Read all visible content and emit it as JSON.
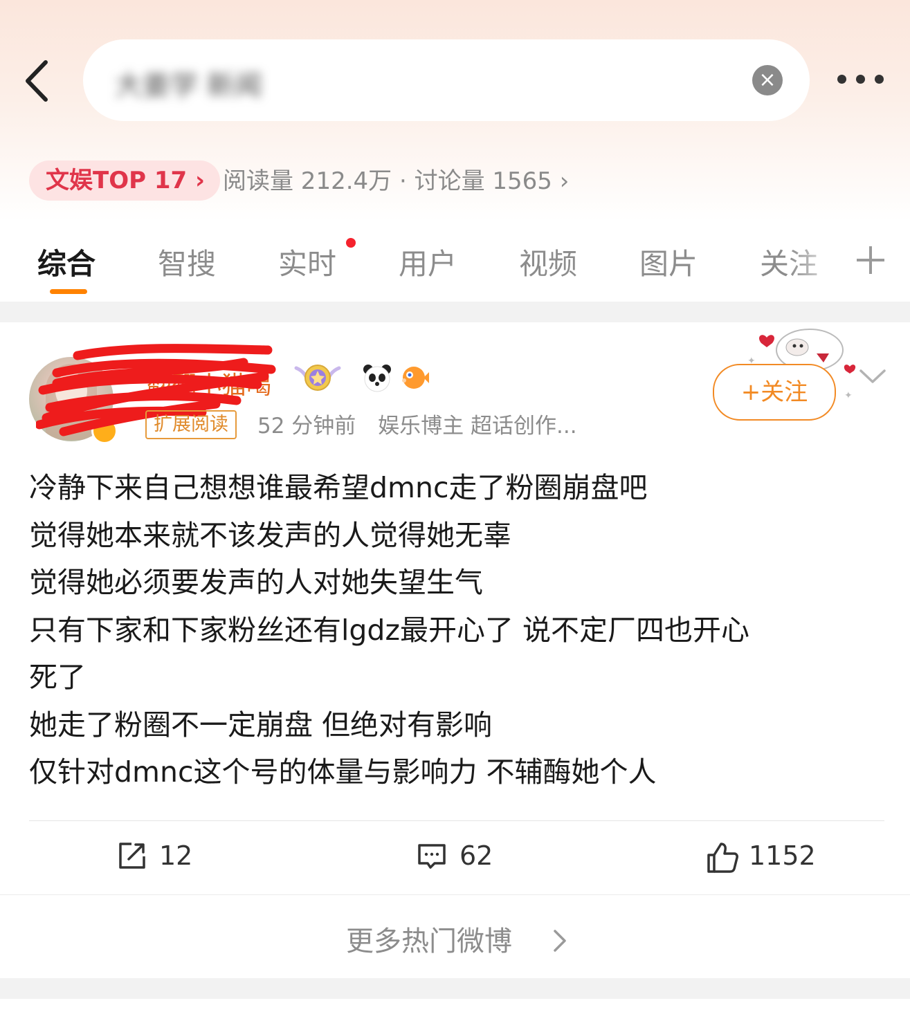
{
  "header": {
    "search_query": "大姜学 新闻",
    "icons": {
      "back": "back-chevron-icon",
      "clear": "clear-x-icon",
      "more": "more-dots-icon"
    }
  },
  "topic": {
    "rank_label": "文娱TOP 17 ›",
    "stats": "阅读量 212.4万 · 讨论量 1565 ›"
  },
  "tabs": [
    {
      "label": "综合",
      "active": true
    },
    {
      "label": "智搜"
    },
    {
      "label": "实时",
      "has_dot": true
    },
    {
      "label": "用户"
    },
    {
      "label": "视频"
    },
    {
      "label": "图片"
    },
    {
      "label": "关注"
    }
  ],
  "post": {
    "username": "翻翻小猫喝",
    "expand_tag": "扩展阅读",
    "time": "52 分钟前",
    "author_tags": "娱乐博主 超话创作...",
    "follow_label": "+关注",
    "lines": [
      "冷静下来自己想想谁最希望dmnc走了粉圈崩盘吧",
      "觉得她本来就不该发声的人觉得她无辜",
      "觉得她必须要发声的人对她失望生气",
      "只有下家和下家粉丝还有lgdz最开心了 说不定厂四也开心",
      "死了",
      "她走了粉圈不一定崩盘 但绝对有影响",
      "仅针对dmnc这个号的体量与影响力 不辅酶她个人"
    ],
    "actions": {
      "reposts": "12",
      "comments": "62",
      "likes": "1152"
    }
  },
  "more_hot_label": "更多热门微博",
  "colors": {
    "accent": "#ff8200",
    "rank_red": "#e0354a",
    "follow_orange": "#f28a24"
  }
}
